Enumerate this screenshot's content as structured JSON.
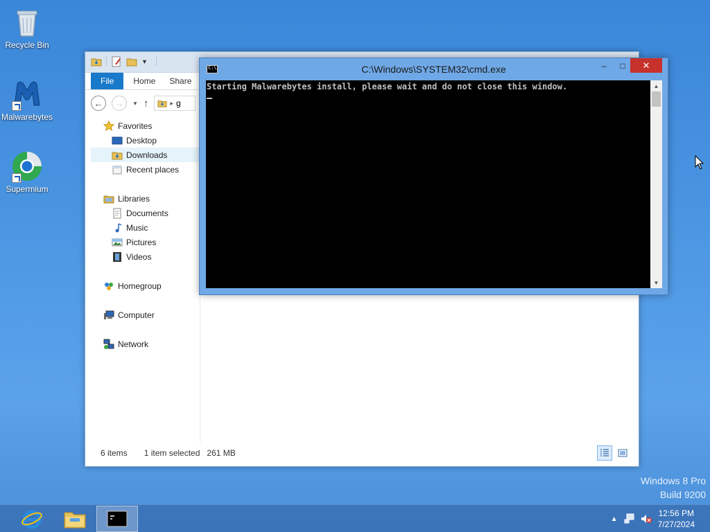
{
  "desktop": {
    "icons": [
      {
        "label": "Recycle Bin"
      },
      {
        "label": "Malwarebytes"
      },
      {
        "label": "Supermium"
      }
    ],
    "watermark": {
      "line1": "Windows 8 Pro",
      "line2": "Build 9200"
    }
  },
  "explorer": {
    "tabs": [
      {
        "label": "File"
      },
      {
        "label": "Home"
      },
      {
        "label": "Share"
      }
    ],
    "address_fragment": "g",
    "nav": {
      "favorites": "Favorites",
      "desktop": "Desktop",
      "downloads": "Downloads",
      "recent": "Recent places",
      "libraries": "Libraries",
      "documents": "Documents",
      "music": "Music",
      "pictures": "Pictures",
      "videos": "Videos",
      "homegroup": "Homegroup",
      "computer": "Computer",
      "network": "Network"
    },
    "status": {
      "items": "6 items",
      "selected": "1 item selected",
      "size": "261 MB"
    }
  },
  "cmd": {
    "title": "C:\\Windows\\SYSTEM32\\cmd.exe",
    "output": "Starting Malwarebytes install, please wait and do not close this window.",
    "minimize": "–",
    "maximize": "□",
    "close": "✕"
  },
  "taskbar": {
    "clock_time": "12:56 PM",
    "clock_date": "7/27/2024",
    "tray_chevron": "▲"
  },
  "colors": {
    "accent": "#1979ca",
    "close_red": "#c7312b"
  }
}
